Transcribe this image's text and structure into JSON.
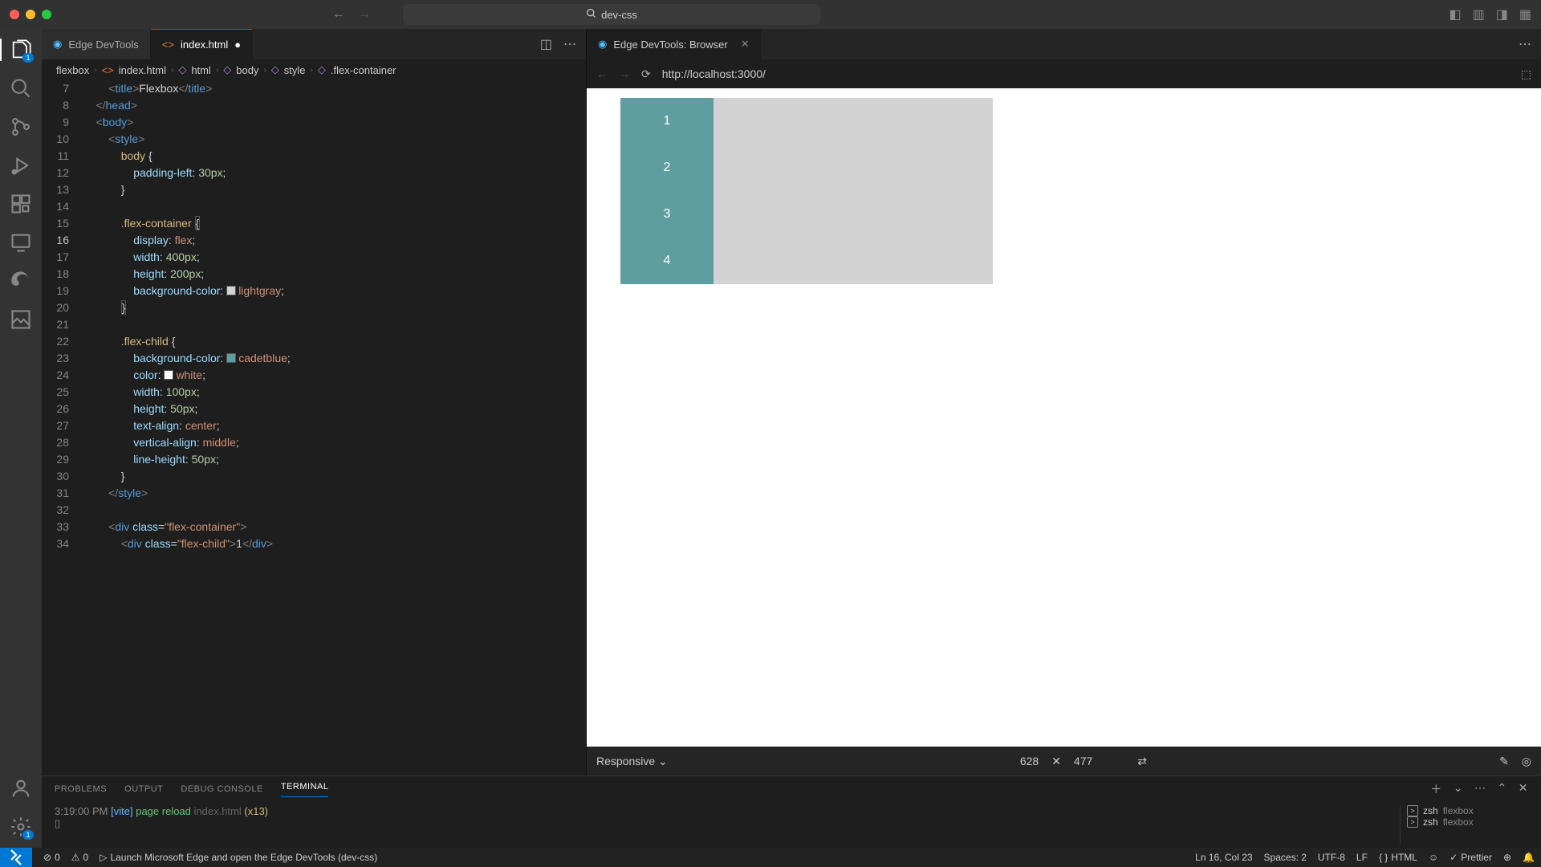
{
  "title_bar": {
    "search_text": "dev-css"
  },
  "activity": {
    "explorer_badge": "1"
  },
  "tabs": {
    "devtools": "Edge DevTools",
    "index": "index.html",
    "preview": "Edge DevTools: Browser"
  },
  "breadcrumbs": [
    "flexbox",
    "index.html",
    "html",
    "body",
    "style",
    ".flex-container"
  ],
  "code": {
    "line_start": 7,
    "cursor_line": 16
  },
  "browser": {
    "url": "http://localhost:3000/"
  },
  "preview_children": [
    "1",
    "2",
    "3",
    "4"
  ],
  "devtools_bar": {
    "mode": "Responsive",
    "width": "628",
    "height": "477"
  },
  "panel": {
    "tabs": [
      "PROBLEMS",
      "OUTPUT",
      "DEBUG CONSOLE",
      "TERMINAL"
    ],
    "active": "TERMINAL",
    "terminal": {
      "time": "3:19:00 PM",
      "tag": "[vite]",
      "msg": "page reload",
      "file": "index.html",
      "count": "(x13)"
    },
    "sessions": [
      {
        "shell": "zsh",
        "cwd": "flexbox"
      },
      {
        "shell": "zsh",
        "cwd": "flexbox"
      }
    ]
  },
  "status": {
    "errors": "0",
    "warnings": "0",
    "launch": "Launch Microsoft Edge and open the Edge DevTools (dev-css)",
    "lncol": "Ln 16, Col 23",
    "spaces": "Spaces: 2",
    "encoding": "UTF-8",
    "eol": "LF",
    "lang": "HTML",
    "prettier": "Prettier"
  }
}
